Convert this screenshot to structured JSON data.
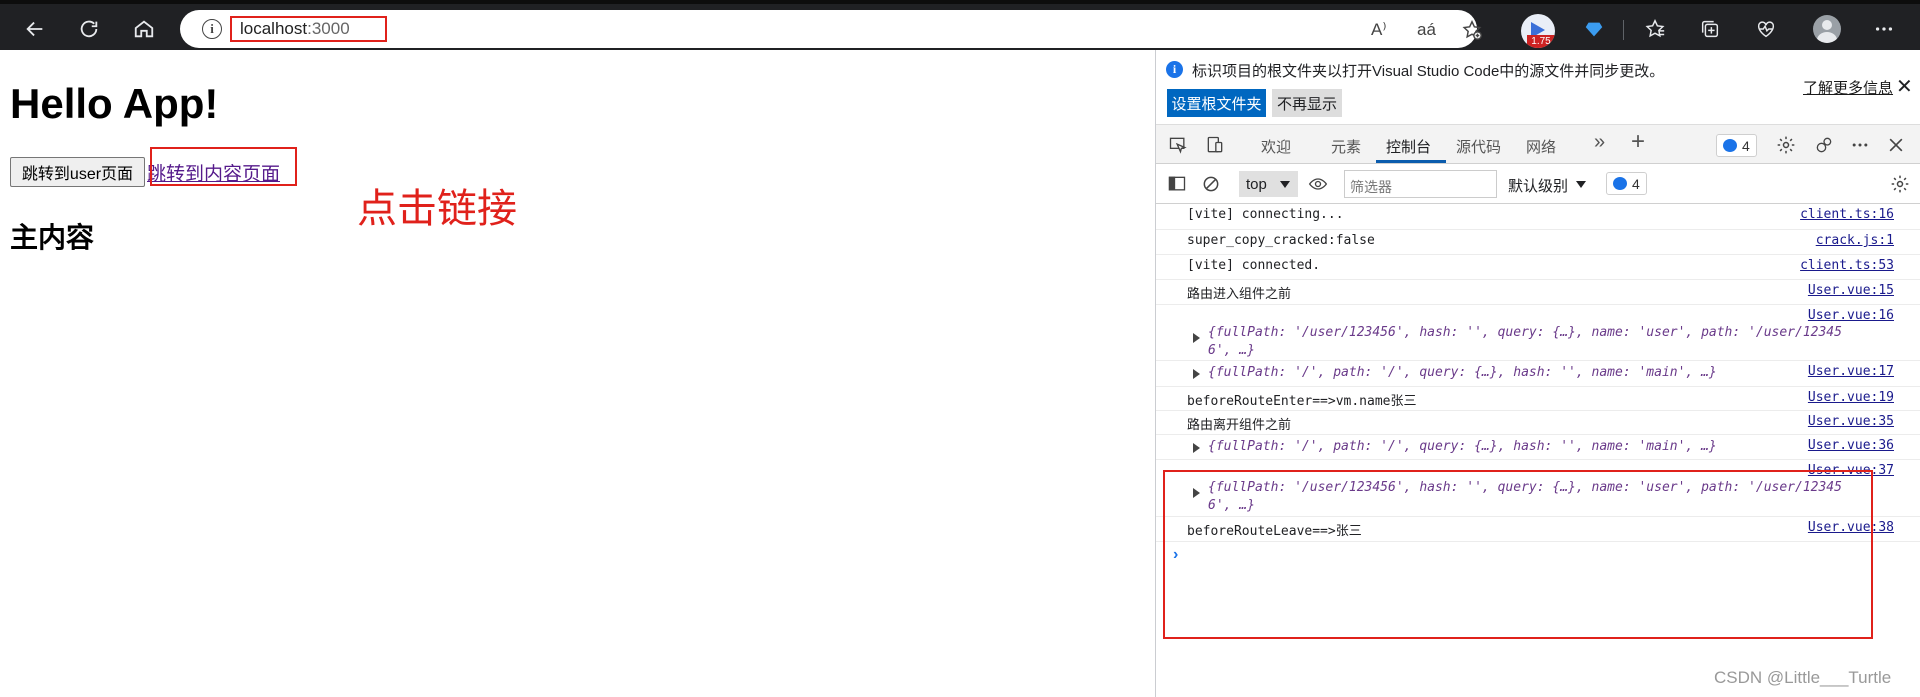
{
  "browser": {
    "url_host": "localhost",
    "url_port": ":3000",
    "info_glyph": "i",
    "read_aloud_glyph": "A⁾",
    "translate_glyph": "aá",
    "extension_badge": "1.75",
    "icons": [
      "back-icon",
      "refresh-icon",
      "home-icon",
      "info-icon",
      "read-aloud-icon",
      "translate-icon",
      "add-favorite-icon",
      "extension-icon",
      "diamond-icon",
      "favorites-icon",
      "collections-icon",
      "health-icon",
      "profile-icon",
      "more-icon"
    ]
  },
  "page": {
    "title": "Hello App!",
    "user_button": "跳转到user页面",
    "content_link": "跳转到内容页面",
    "annotation": "点击链接",
    "heading": "主内容"
  },
  "devtools": {
    "notification": {
      "message": "标识项目的根文件夹以打开Visual Studio Code中的源文件并同步更改。",
      "learn_more": "了解更多信息",
      "set_root": "设置根文件夹",
      "dont_show": "不再显示",
      "close": "✕",
      "info_glyph": "i"
    },
    "tabs": {
      "welcome": "欢迎",
      "elements": "元素",
      "console": "控制台",
      "sources": "源代码",
      "network": "网络",
      "more": "»",
      "add": "+",
      "issues_count": "4"
    },
    "toolbar": {
      "context": "top",
      "filter_placeholder": "筛选器",
      "level": "默认级别",
      "issues_count": "4"
    },
    "console_lines": [
      {
        "text": "[vite] connecting...",
        "source": "client.ts:16"
      },
      {
        "text": "super_copy_cracked:false",
        "source": "crack.js:1"
      },
      {
        "text": "[vite] connected.",
        "source": "client.ts:53"
      },
      {
        "text": "路由进入组件之前",
        "source": "User.vue:15"
      },
      {
        "obj": "{fullPath: '/user/123456', hash: '', query: {…}, name: 'user', path: '/user/12345\n6', …}",
        "source": "User.vue:16"
      },
      {
        "obj": "{fullPath: '/', path: '/', query: {…}, hash: '', name: 'main', …}",
        "source": "User.vue:17"
      },
      {
        "text": "beforeRouteEnter==>vm.name张三",
        "source": "User.vue:19"
      },
      {
        "text": "路由离开组件之前",
        "source": "User.vue:35"
      },
      {
        "obj": "{fullPath: '/', path: '/', query: {…}, hash: '', name: 'main', …}",
        "source": "User.vue:36"
      },
      {
        "obj": "{fullPath: '/user/123456', hash: '', query: {…}, name: 'user', path: '/user/12345\n6', …}",
        "source": "User.vue:37"
      },
      {
        "text": "beforeRouteLeave==>张三",
        "source": "User.vue:38"
      }
    ],
    "prompt": "›"
  },
  "watermark": "CSDN @Little___Turtle",
  "colors": {
    "annotation_red": "#e0211b",
    "link_purple": "#551a8b",
    "primary_blue": "#0067c0"
  }
}
